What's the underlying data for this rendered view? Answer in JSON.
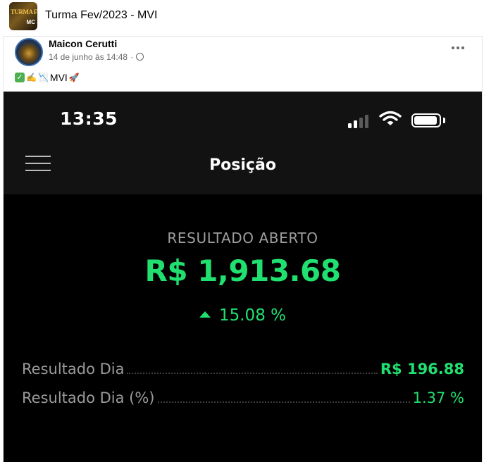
{
  "group": {
    "title": "Turma Fev/2023 - MVI",
    "icon_text_top": "TURMA FEV",
    "icon_text_bottom": "MC"
  },
  "post": {
    "author": "Maicon Cerutti",
    "timestamp": "14 de junho às 14:48",
    "separator": "·",
    "text": "MVI",
    "emojis": [
      "✅",
      "✍️",
      "📉",
      "🚀"
    ]
  },
  "screenshot": {
    "status_time": "13:35",
    "nav_title": "Posição",
    "result_label": "RESULTADO ABERTO",
    "result_value": "R$ 1,913.68",
    "result_change": "15.08 %",
    "rows": [
      {
        "label": "Resultado Dia",
        "value": "R$ 196.88"
      },
      {
        "label": "Resultado Dia (%)",
        "value": "1.37 %"
      }
    ],
    "colors": {
      "positive": "#20e070",
      "background": "#000000",
      "bar_background": "#121212",
      "label": "#9e9e9e"
    }
  }
}
